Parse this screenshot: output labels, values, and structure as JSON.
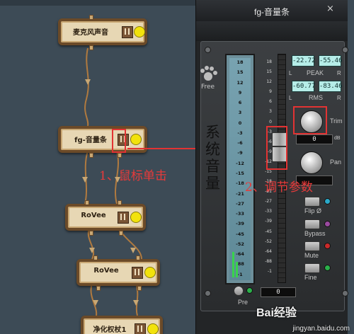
{
  "graph": {
    "nodes": [
      {
        "label": "麦克风声音"
      },
      {
        "label": "fg-音量条"
      },
      {
        "label": "RoVee"
      },
      {
        "label": "RoVee"
      },
      {
        "label": "净化权杖1"
      }
    ]
  },
  "annotations": {
    "step1": "1、鼠标单击",
    "step2": "2、调节参数",
    "system_volume": "系统音量"
  },
  "plugin": {
    "title": "fg-音量条",
    "close_glyph": "×",
    "logo_text": "Free",
    "meter_ticks": [
      "18",
      "15",
      "12",
      "9",
      "6",
      "3",
      "0",
      "-3",
      "-6",
      "-9",
      "-12",
      "-15",
      "-18",
      "-21",
      "-27",
      "-33",
      "-39",
      "-45",
      "-52",
      "-64",
      "-88",
      "-1"
    ],
    "fader_ticks": [
      "18",
      "15",
      "12",
      "9",
      "6",
      "3",
      "0",
      "-3",
      "-6",
      "-9",
      "-12",
      "-15",
      "-18",
      "-21",
      "-27",
      "-33",
      "-39",
      "-45",
      "-52",
      "-64",
      "-88",
      "-1"
    ],
    "peak": {
      "left": "-22.72",
      "right": "-55.46",
      "label": "PEAK"
    },
    "rms": {
      "left": "-60.77",
      "right": "-83.46",
      "label": "RMS"
    },
    "lr": {
      "left": "L",
      "right": "R"
    },
    "trim": {
      "label": "Trim",
      "value": "0",
      "unit": "dB"
    },
    "pan": {
      "label": "Pan"
    },
    "buttons": [
      {
        "label": "Flip Ø",
        "led_color": "#2aa9c9"
      },
      {
        "label": "Bypass",
        "led_color": "#9a4aa0"
      },
      {
        "label": "Mute",
        "led_color": "#c92a2a"
      },
      {
        "label": "Fine",
        "led_color": "#2bb04a"
      }
    ],
    "pre": {
      "label": "Pre"
    },
    "fader_value": "0"
  },
  "watermark": {
    "brand": "Bai经验",
    "url": "jingyan.baidu.com"
  },
  "colors": {
    "annotation": "#e23333",
    "accent_yellow": "#f2e20c"
  }
}
